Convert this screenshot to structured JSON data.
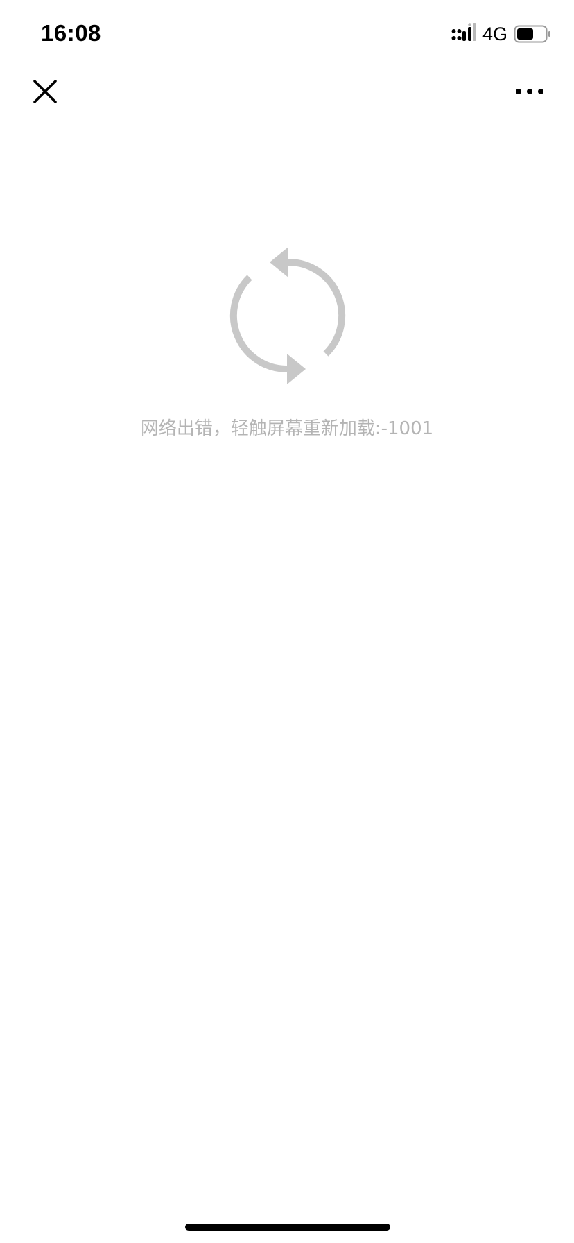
{
  "status_bar": {
    "time": "16:08",
    "network": "4G",
    "signal_icon": "cellular-signal-icon",
    "battery_icon": "battery-icon"
  },
  "nav": {
    "close_icon": "close-icon",
    "more_icon": "more-icon"
  },
  "error": {
    "icon": "reload-icon",
    "message": "网络出错，轻触屏幕重新加载:-1001"
  },
  "colors": {
    "background": "#ffffff",
    "icon_gray": "#c8c8c8",
    "message_gray": "#b4b4b4",
    "foreground": "#000000"
  }
}
